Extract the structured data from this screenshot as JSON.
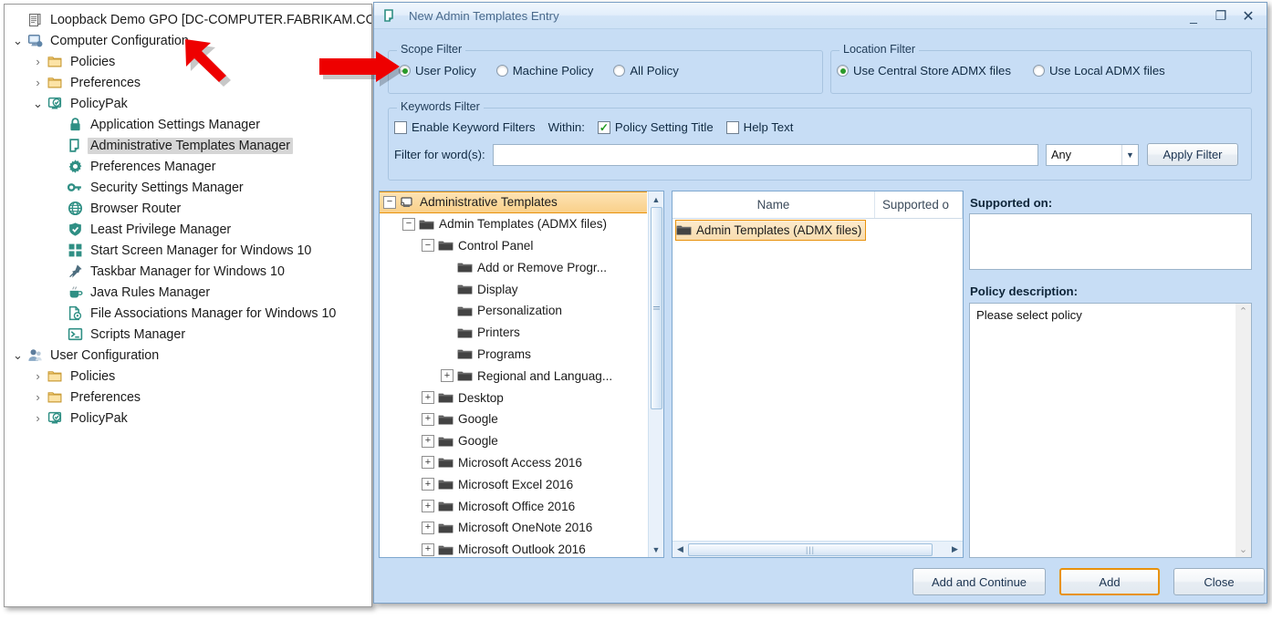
{
  "gpmc": {
    "root": {
      "label": "Loopback Demo GPO [DC-COMPUTER.FABRIKAM.COM]",
      "icon": "gpo-scroll-icon"
    },
    "tree": [
      {
        "label": "Computer Configuration",
        "icon": "computer-icon",
        "indent": 0,
        "chevron": "down"
      },
      {
        "label": "Policies",
        "icon": "folder-icon",
        "indent": 1,
        "chevron": "right"
      },
      {
        "label": "Preferences",
        "icon": "folder-icon",
        "indent": 1,
        "chevron": "right"
      },
      {
        "label": "PolicyPak",
        "icon": "policypak-icon",
        "indent": 1,
        "chevron": "down"
      },
      {
        "label": "Application Settings Manager",
        "icon": "lock-icon",
        "indent": 2,
        "chevron": "none"
      },
      {
        "label": "Administrative Templates Manager",
        "icon": "admin-templates-icon",
        "indent": 2,
        "chevron": "none",
        "selected": true
      },
      {
        "label": "Preferences Manager",
        "icon": "gear-icon",
        "indent": 2,
        "chevron": "none"
      },
      {
        "label": "Security Settings Manager",
        "icon": "key-icon",
        "indent": 2,
        "chevron": "none"
      },
      {
        "label": "Browser Router",
        "icon": "globe-icon",
        "indent": 2,
        "chevron": "none"
      },
      {
        "label": "Least Privilege Manager",
        "icon": "shield-icon",
        "indent": 2,
        "chevron": "none"
      },
      {
        "label": "Start Screen Manager for Windows 10",
        "icon": "windows-tiles-icon",
        "indent": 2,
        "chevron": "none"
      },
      {
        "label": "Taskbar Manager for Windows 10",
        "icon": "pin-icon",
        "indent": 2,
        "chevron": "none"
      },
      {
        "label": "Java Rules Manager",
        "icon": "coffee-cup-icon",
        "indent": 2,
        "chevron": "none"
      },
      {
        "label": "File Associations Manager for Windows 10",
        "icon": "file-gear-icon",
        "indent": 2,
        "chevron": "none"
      },
      {
        "label": "Scripts Manager",
        "icon": "script-console-icon",
        "indent": 2,
        "chevron": "none"
      },
      {
        "label": "User Configuration",
        "icon": "user-icon",
        "indent": 0,
        "chevron": "down"
      },
      {
        "label": "Policies",
        "icon": "folder-icon",
        "indent": 1,
        "chevron": "right"
      },
      {
        "label": "Preferences",
        "icon": "folder-icon",
        "indent": 1,
        "chevron": "right"
      },
      {
        "label": "PolicyPak",
        "icon": "policypak-icon",
        "indent": 1,
        "chevron": "right"
      }
    ]
  },
  "dialog": {
    "title": "New Admin Templates Entry",
    "title_icon": "admin-templates-icon",
    "window_buttons": {
      "minimize": "_",
      "maximize": "❐",
      "close": "✕"
    },
    "scope_filter": {
      "legend": "Scope Filter",
      "options": [
        {
          "label": "User Policy",
          "selected": true
        },
        {
          "label": "Machine Policy",
          "selected": false
        },
        {
          "label": "All Policy",
          "selected": false
        }
      ]
    },
    "location_filter": {
      "legend": "Location Filter",
      "options": [
        {
          "label": "Use Central Store ADMX files",
          "selected": true
        },
        {
          "label": "Use Local ADMX files",
          "selected": false
        }
      ]
    },
    "keywords_filter": {
      "legend": "Keywords Filter",
      "enable_label": "Enable Keyword Filters",
      "enable_checked": false,
      "within_label": "Within:",
      "within_options": [
        {
          "label": "Policy Setting Title",
          "checked": true
        },
        {
          "label": "Help Text",
          "checked": false
        }
      ],
      "filter_label": "Filter for word(s):",
      "filter_value": "",
      "filter_placeholder": "",
      "match_mode": "Any",
      "apply_button": "Apply Filter"
    },
    "tree": [
      {
        "label": "Administrative Templates",
        "indent": 0,
        "expander": "minus",
        "icon": "admin-templates-icon",
        "selected": true
      },
      {
        "label": "Admin Templates (ADMX files)",
        "indent": 1,
        "expander": "minus",
        "icon": "folder-icon"
      },
      {
        "label": "Control Panel",
        "indent": 2,
        "expander": "minus",
        "icon": "folder-icon"
      },
      {
        "label": "Add or Remove Progr...",
        "indent": 3,
        "expander": "none",
        "icon": "folder-icon"
      },
      {
        "label": "Display",
        "indent": 3,
        "expander": "none",
        "icon": "folder-icon"
      },
      {
        "label": "Personalization",
        "indent": 3,
        "expander": "none",
        "icon": "folder-icon"
      },
      {
        "label": "Printers",
        "indent": 3,
        "expander": "none",
        "icon": "folder-icon"
      },
      {
        "label": "Programs",
        "indent": 3,
        "expander": "none",
        "icon": "folder-icon"
      },
      {
        "label": "Regional and Languag...",
        "indent": 3,
        "expander": "plus",
        "icon": "folder-icon"
      },
      {
        "label": "Desktop",
        "indent": 2,
        "expander": "plus",
        "icon": "folder-icon"
      },
      {
        "label": "Google",
        "indent": 2,
        "expander": "plus",
        "icon": "folder-icon"
      },
      {
        "label": "Google",
        "indent": 2,
        "expander": "plus",
        "icon": "folder-icon"
      },
      {
        "label": "Microsoft Access 2016",
        "indent": 2,
        "expander": "plus",
        "icon": "folder-icon"
      },
      {
        "label": "Microsoft Excel 2016",
        "indent": 2,
        "expander": "plus",
        "icon": "folder-icon"
      },
      {
        "label": "Microsoft Office 2016",
        "indent": 2,
        "expander": "plus",
        "icon": "folder-icon"
      },
      {
        "label": "Microsoft OneNote 2016",
        "indent": 2,
        "expander": "plus",
        "icon": "folder-icon"
      },
      {
        "label": "Microsoft Outlook 2016",
        "indent": 2,
        "expander": "plus",
        "icon": "folder-icon"
      }
    ],
    "list": {
      "columns": [
        "Name",
        "Supported o"
      ],
      "rows": [
        {
          "name": "Admin Templates (ADMX files)",
          "supported_on": "",
          "icon": "folder-icon",
          "selected": true
        }
      ]
    },
    "supported_on": {
      "label": "Supported on:",
      "value": ""
    },
    "policy_description": {
      "label": "Policy description:",
      "value": "Please select policy"
    },
    "buttons": [
      {
        "label": "Add and Continue",
        "focused": false
      },
      {
        "label": "Add",
        "focused": true
      },
      {
        "label": "Close",
        "focused": false
      }
    ]
  },
  "annotations": {
    "arrows": [
      {
        "name": "arrow-pointing-to-administrative-templates-manager",
        "color": "#ee0000"
      },
      {
        "name": "arrow-pointing-to-scope-filter",
        "color": "#ee0000"
      }
    ]
  },
  "colors": {
    "accent_teal": "#2f8f84",
    "selection_orange": "#e8920c",
    "dialog_bg": "#c7ddf5",
    "arrow_red": "#ee0000"
  }
}
